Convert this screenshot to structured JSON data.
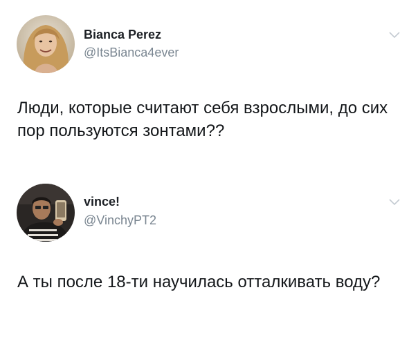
{
  "tweets": [
    {
      "name": "Bianca Perez",
      "handle": "@ItsBianca4ever",
      "text": "Люди, которые считают себя взрослыми, до сих пор пользуются зонтами??",
      "avatar_icon": "profile-photo"
    },
    {
      "name": "vince!",
      "handle": "@VinchyPT2",
      "text": "А ты после 18-ти научилась отталкивать воду?",
      "avatar_icon": "profile-photo"
    }
  ],
  "colors": {
    "text": "#14171a",
    "name": "#1c2025",
    "handle": "#7a8691",
    "chevron": "#c4cbd2"
  }
}
